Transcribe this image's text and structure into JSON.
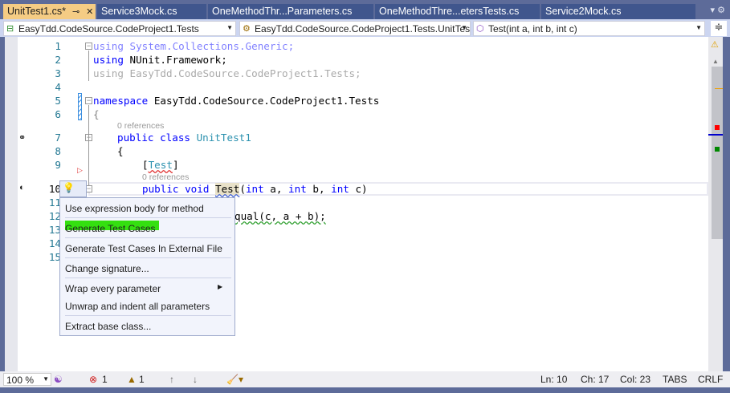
{
  "tabs": [
    {
      "label": "UnitTest1.cs*",
      "active": true
    },
    {
      "label": "Service3Mock.cs"
    },
    {
      "label": "OneMethodThr...Parameters.cs"
    },
    {
      "label": "OneMethodThre...etersTests.cs"
    },
    {
      "label": "Service2Mock.cs"
    }
  ],
  "nav": {
    "project": "EasyTdd.CodeSource.CodeProject1.Tests",
    "type": "EasyTdd.CodeSource.CodeProject1.Tests.UnitTes",
    "member": "Test(int a, int b, int c)"
  },
  "code": {
    "l1": "using System.Collections.Generic;",
    "l2a": "using",
    "l2b": " NUnit.Framework;",
    "l3": "using EasyTdd.CodeSource.CodeProject1.Tests;",
    "l5a": "namespace",
    "l5b": " EasyTdd.CodeSource.CodeProject1.Tests",
    "l6": "{",
    "refs7": "0 references",
    "l7a": "public class",
    "l7b": "UnitTest1",
    "l8": "{",
    "l9a": "[",
    "l9b": "Test",
    "l9c": "]",
    "refs10": "0 references",
    "l10a": "public void",
    "l10b": "Test",
    "l10c": "(",
    "l10d": "int",
    "l10e": " a, ",
    "l10f": "int",
    "l10g": " b, ",
    "l10h": "int",
    "l10i": " c)",
    "l12": "qual(c, a + b);"
  },
  "line_numbers": [
    "1",
    "2",
    "3",
    "4",
    "5",
    "6",
    "7",
    "8",
    "9",
    "10",
    "11",
    "12",
    "13",
    "14",
    "15"
  ],
  "menu": [
    "Use expression body for method",
    "Generate Test Cases",
    "Generate Test Cases In External File",
    "Change signature...",
    "Wrap every parameter",
    "Unwrap and indent all parameters",
    "Extract base class..."
  ],
  "status": {
    "zoom": "100 %",
    "errors": "1",
    "warnings": "1",
    "ln": "Ln: 10",
    "ch": "Ch: 17",
    "col": "Col: 23",
    "tabs": "TABS",
    "eol": "CRLF"
  }
}
